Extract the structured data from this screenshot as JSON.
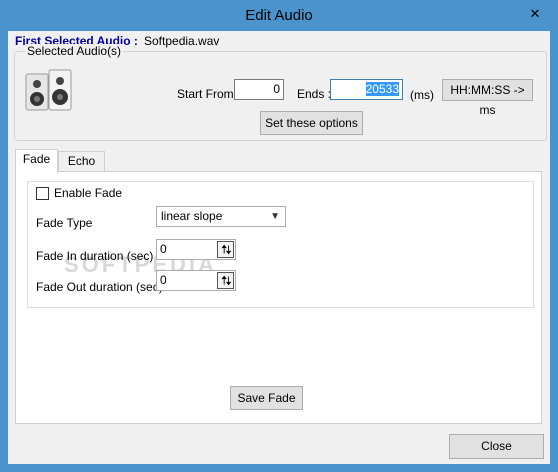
{
  "window": {
    "title": "Edit Audio",
    "close_glyph": "✕"
  },
  "header": {
    "first_selected_label": "First Selected Audio :",
    "first_selected_value": "Softpedia.wav"
  },
  "selected_group": {
    "title": "Selected Audio(s)",
    "icon": "speaker-icon",
    "start_from_label": "Start From :",
    "start_from_value": "0",
    "ends_label": "Ends :",
    "ends_value": "20533",
    "unit_label": "(ms)",
    "convert_button": "HH:MM:SS -> ms",
    "set_button": "Set these options"
  },
  "tabs": [
    {
      "label": "Fade",
      "active": true
    },
    {
      "label": "Echo",
      "active": false
    }
  ],
  "fade": {
    "enable_label": "Enable Fade",
    "enable_checked": false,
    "type_label": "Fade Type",
    "type_value": "linear slope",
    "in_label": "Fade In duration (sec)",
    "in_value": "0",
    "out_label": "Fade Out duration (sec)",
    "out_value": "0",
    "save_button": "Save Fade",
    "watermark": "SOFTPEDIA"
  },
  "footer": {
    "close_button": "Close"
  },
  "colors": {
    "title_bar": "#4a93cc",
    "heading_blue": "#0000a0",
    "selection": "#3399ff"
  }
}
